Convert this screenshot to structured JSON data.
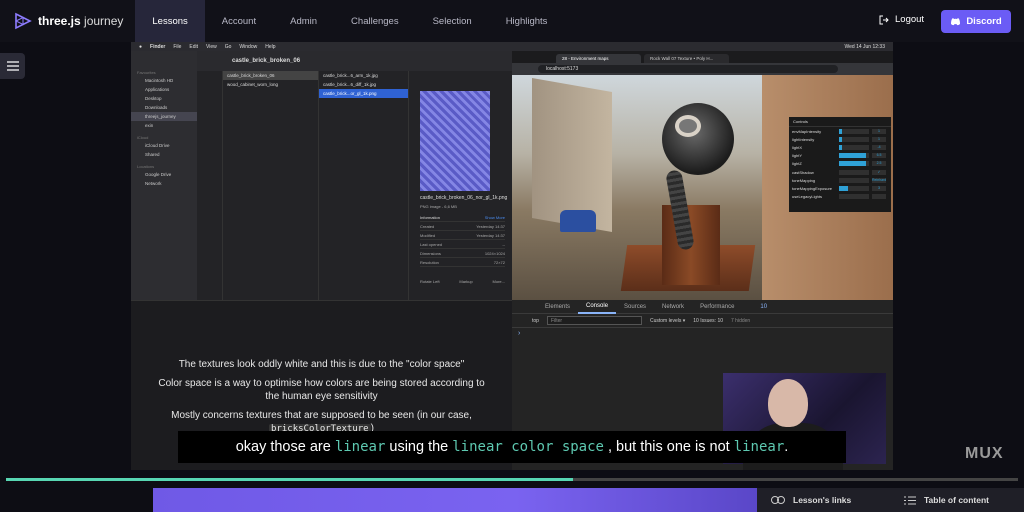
{
  "nav": {
    "logo_bold": "three.js",
    "logo_light": "journey",
    "links": [
      "Lessons",
      "Account",
      "Admin",
      "Challenges",
      "Selection",
      "Highlights"
    ],
    "logout": "Logout",
    "discord": "Discord"
  },
  "mac": {
    "menu": [
      "Finder",
      "File",
      "Edit",
      "View",
      "Go",
      "Window",
      "Help"
    ],
    "clock": "Wed 14 Jun 12:33"
  },
  "finder": {
    "folder": "castle_brick_broken_06",
    "sidebar": {
      "favourites_head": "Favourites",
      "favourites": [
        "Macintosh HD",
        "Applications",
        "Desktop",
        "Downloads",
        "threejs_journey",
        "exin"
      ],
      "cloud_head": "iCloud",
      "cloud": [
        "iCloud Drive",
        "Shared"
      ],
      "locations_head": "Locations",
      "locations": [
        "Google Drive",
        "Network"
      ]
    },
    "col1": [
      "castle_brick_broken_06",
      "wood_cabinet_worn_long"
    ],
    "col2": [
      "castle_brick...6_arm_1k.jpg",
      "castle_brick...6_diff_1k.jpg",
      "castle_brick...or_gl_1k.png"
    ],
    "info": {
      "filename": "castle_brick_broken_06_nor_gl_1k.png",
      "kind": "PNG image - 6,6 MB",
      "information": "Information",
      "show_more": "Show More",
      "rows": [
        {
          "k": "Created",
          "v": "Yesterday 14:37"
        },
        {
          "k": "Modified",
          "v": "Yesterday 14:37"
        },
        {
          "k": "Last opened",
          "v": "--"
        },
        {
          "k": "Dimensions",
          "v": "1024×1024"
        },
        {
          "k": "Resolution",
          "v": "72×72"
        }
      ],
      "actions": [
        "Rotate Left",
        "Markup",
        "More..."
      ]
    }
  },
  "browser": {
    "tabs": [
      "28 - Environment maps",
      "Rock Wall 07 Texture • Poly H..."
    ],
    "url": "localhost:5173",
    "controls_title": "Controls",
    "controls": [
      {
        "label": "envMapIntensity",
        "fill": 0.1,
        "value": "1"
      },
      {
        "label": "lightIntensity",
        "fill": 0.1,
        "value": "1"
      },
      {
        "label": "lightX",
        "fill": 0.1,
        "value": "-4"
      },
      {
        "label": "lightY",
        "fill": 0.9,
        "value": "6.5"
      },
      {
        "label": "lightZ",
        "fill": 0.9,
        "value": "2.5"
      },
      {
        "label": "castShadow",
        "fill": 0,
        "value": "✓"
      },
      {
        "label": "toneMapping",
        "fill": 0,
        "value": "Reinhard"
      },
      {
        "label": "toneMappingExposure",
        "fill": 0.3,
        "value": "3"
      },
      {
        "label": "useLegacyLights",
        "fill": 0,
        "value": ""
      }
    ]
  },
  "devtools": {
    "tabs": [
      "Elements",
      "Console",
      "Sources",
      "Network",
      "Performance"
    ],
    "badge": "10",
    "context": "top",
    "filter_placeholder": "Filter",
    "levels": "Custom levels ▾",
    "issues": "10 Issues: 10",
    "hidden": "7 hidden",
    "prompt": "›"
  },
  "slide": {
    "line1": "The textures look oddly white and this is due to the \"color space\"",
    "line2": "Color space is a way to optimise how colors are being stored according to",
    "line3": "the human eye sensitivity",
    "line4": "Mostly concerns textures that are supposed to be seen (in our case,",
    "code": "bricksColorTexture",
    "after_code": ")"
  },
  "subtitle": {
    "p1": "okay those are",
    "m1": "linear",
    "p2": "using the",
    "m2": "linear color space",
    "p3": ", but this one is not",
    "m3": "linear",
    "p4": "."
  },
  "mux": "MUX",
  "progress": {
    "played": 0.56
  },
  "bottom": {
    "links": "Lesson's links",
    "toc": "Table of content"
  },
  "colors": {
    "accent": "#6b5cf5",
    "progress": "#58d6b3",
    "code": "#5ec9b1"
  }
}
